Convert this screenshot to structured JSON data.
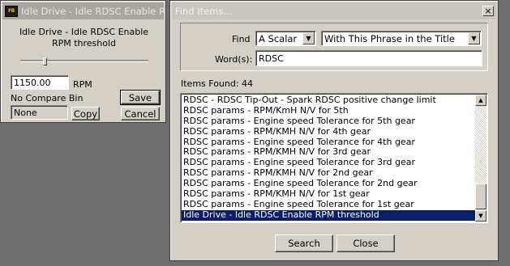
{
  "idle_window": {
    "title": "Idle Drive - Idle RDSC Enable RPM threshold",
    "description": "Idle Drive - Idle RDSC Enable RPM threshold",
    "value": "1150.00",
    "units": "RPM",
    "compare_label": "No Compare Bin",
    "compare_value": "None",
    "save_label": "Save",
    "copy_label": "Copy",
    "cancel_label": "Cancel",
    "slider_fraction": 0.18
  },
  "find_window": {
    "title": "Find Items...",
    "close_glyph": "×",
    "find_label": "Find",
    "find_type": "A Scalar",
    "find_mode": "With This Phrase in the Title",
    "words_label": "Word(s):",
    "words_value": "RDSC",
    "items_found_label": "Items Found: 44",
    "results": [
      "RDSC - RDSC Tip-Out - Spark RDSC positive change limit",
      "RDSC params - RPM/KmH N/V for 5th",
      "RDSC params - Engine speed Tolerance for 5th gear",
      "RDSC params - RPM/KMH N/V for 4th gear",
      "RDSC params - Engine speed Tolerance for 4th gear",
      "RDSC params - RPM/KMH N/V for 3rd gear",
      "RDSC params - Engine speed Tolerance for 3rd gear",
      "RDSC params - RPM/KMH N/V for 2nd gear",
      "RDSC params - Engine speed Tolerance for 2nd gear",
      "RDSC params - RPM/KMH N/V for 1st gear",
      "RDSC params - Engine speed Tolerance for 1st gear",
      "Idle Drive - Idle RDSC Enable RPM threshold"
    ],
    "selected_index": 11,
    "search_label": "Search",
    "close_label": "Close"
  }
}
